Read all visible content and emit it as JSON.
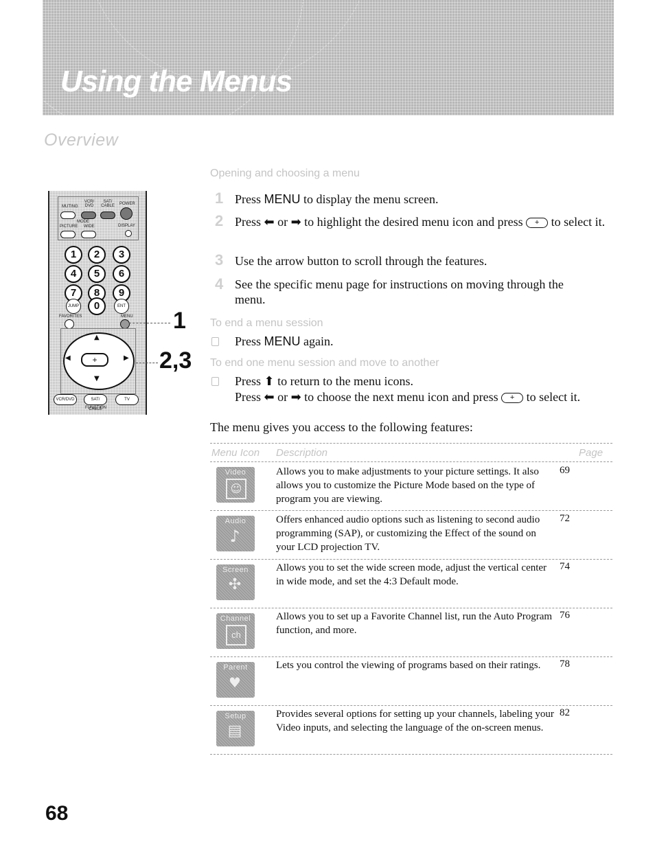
{
  "banner": {
    "title": "Using the Menus"
  },
  "section_title": "Overview",
  "remote": {
    "labels": {
      "muting": "MUTING",
      "vcr_dvd": "VCR/ DVD",
      "sat_cable": "SAT/ CABLE",
      "power": "POWER",
      "mode": "MODE",
      "picture": "PICTURE",
      "wide": "WIDE",
      "display": "DISPLAY",
      "jump": "JUMP",
      "ent": "ENT",
      "favorites": "FAVORITES",
      "menu": "MENU",
      "function": "FUNCTION",
      "fn_vcr_dvd": "VCR/DVD",
      "fn_sat_cable": "SAT/ CABLE",
      "fn_tv": "TV"
    },
    "digits": [
      "1",
      "2",
      "3",
      "4",
      "5",
      "6",
      "7",
      "8",
      "9",
      "0"
    ],
    "center_symbol": "+",
    "callouts": [
      "1",
      "2,3"
    ]
  },
  "opening": {
    "heading": "Opening and choosing a menu",
    "steps": [
      {
        "num": "1",
        "pre": "Press ",
        "key": "MENU",
        "post": " to display the menu screen."
      },
      {
        "num": "2",
        "text_a": "Press ⬅ or ➡ to highlight the desired menu icon and press ",
        "text_b": " to select it."
      },
      {
        "num": "3",
        "text": "Use the arrow button to scroll through the features."
      },
      {
        "num": "4",
        "text": "See the specific menu page for instructions on moving through the menu."
      }
    ]
  },
  "end_session": {
    "heading": "To end a menu session",
    "pre": "Press ",
    "key": "MENU",
    "post": " again."
  },
  "move_session": {
    "heading": "To end one menu session and move to another",
    "line1": "Press ⬆ to return to the menu icons.",
    "line2_a": "Press ⬅ or ➡ to choose the next menu icon and press ",
    "line2_b": " to select it."
  },
  "enter_symbol": "+",
  "intro": "The menu gives you access to the following features:",
  "table": {
    "headers": {
      "icon": "Menu Icon",
      "description": "Description",
      "page": "Page"
    },
    "rows": [
      {
        "icon_label": "Video",
        "icon": "portrait-icon",
        "glyph": "☺",
        "description": "Allows you to make adjustments to your picture settings. It also allows you to customize the Picture Mode based on the type of program you are viewing.",
        "page": "69"
      },
      {
        "icon_label": "Audio",
        "icon": "music-note-icon",
        "glyph": "♪",
        "description": "Offers enhanced audio options such as listening to second audio programming (SAP), or customizing the Effect of the sound on your LCD projection TV.",
        "page": "72"
      },
      {
        "icon_label": "Screen",
        "icon": "screen-arrows-icon",
        "glyph": "✣",
        "description": "Allows you to set the wide screen mode, adjust the vertical center in wide mode, and set the 4:3 Default mode.",
        "page": "74"
      },
      {
        "icon_label": "Channel",
        "icon": "channel-icon",
        "glyph": "ch",
        "description": "Allows you to set up a Favorite Channel list, run the Auto Program function, and more.",
        "page": "76"
      },
      {
        "icon_label": "Parent",
        "icon": "parent-bear-icon",
        "glyph": "♥",
        "description": "Lets you control the viewing of programs based on their ratings.",
        "page": "78"
      },
      {
        "icon_label": "Setup",
        "icon": "toolbox-icon",
        "glyph": "▤",
        "description": "Provides several options for  setting up your channels, labeling your Video inputs, and selecting the language of the on-screen menus.",
        "page": "82"
      }
    ]
  },
  "page_number": "68"
}
